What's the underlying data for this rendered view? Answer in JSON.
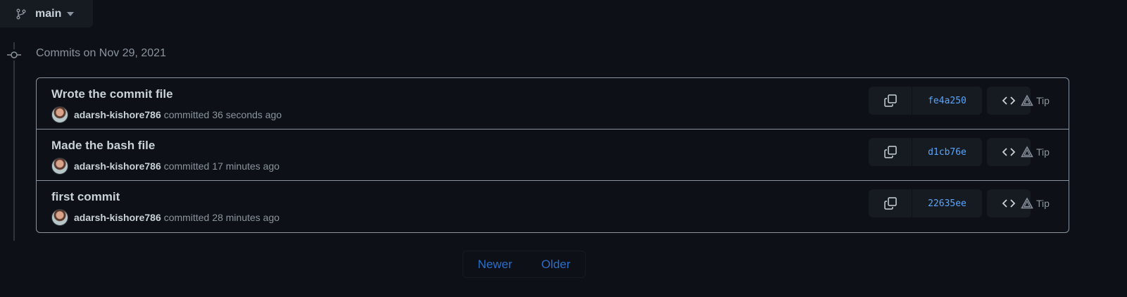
{
  "branch": {
    "name": "main",
    "icon": "git-branch-icon"
  },
  "group": {
    "heading": "Commits on Nov 29, 2021"
  },
  "commits": [
    {
      "title": "Wrote the commit file",
      "author": "adarsh-kishore786",
      "action": "committed",
      "when": "36 seconds ago",
      "sha": "fe4a250",
      "tip": "Tip"
    },
    {
      "title": "Made the bash file",
      "author": "adarsh-kishore786",
      "action": "committed",
      "when": "17 minutes ago",
      "sha": "d1cb76e",
      "tip": "Tip"
    },
    {
      "title": "first commit",
      "author": "adarsh-kishore786",
      "action": "committed",
      "when": "28 minutes ago",
      "sha": "22635ee",
      "tip": "Tip"
    }
  ],
  "pagination": {
    "newer": "Newer",
    "older": "Older"
  },
  "colors": {
    "background": "#0d1117",
    "link": "#58a6ff",
    "muted": "#8b949e",
    "border": "#8b949e"
  }
}
